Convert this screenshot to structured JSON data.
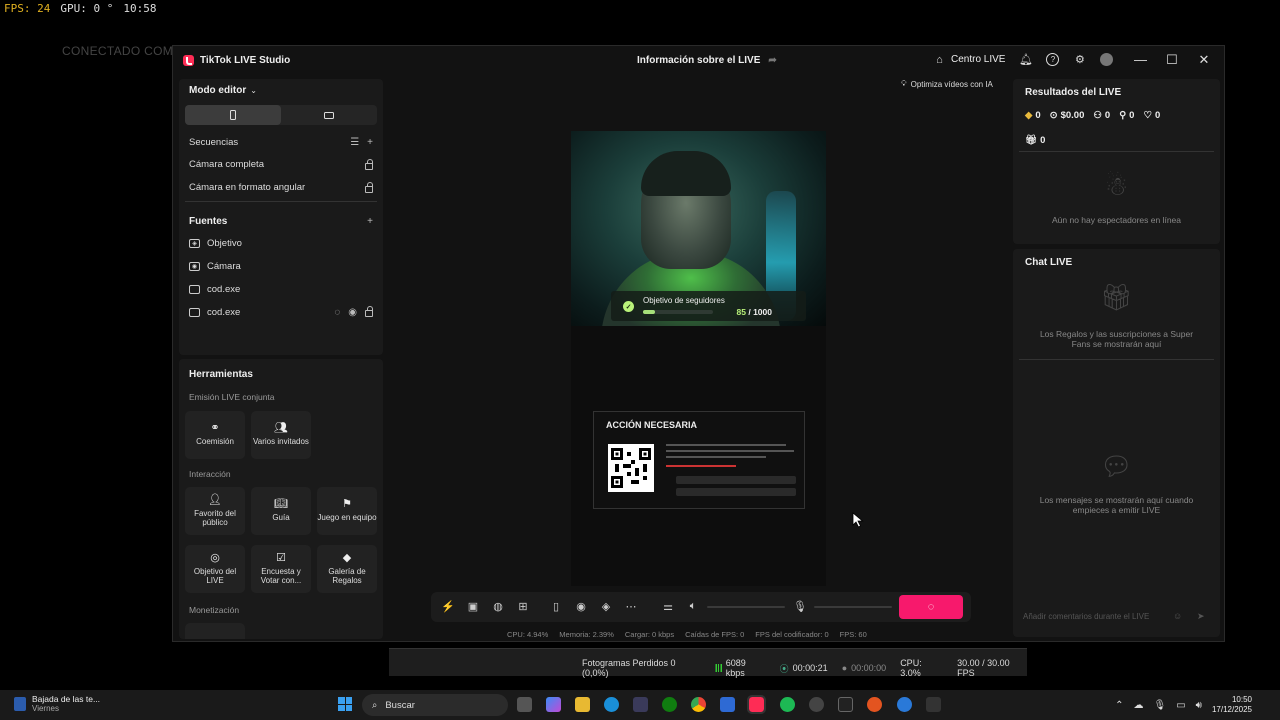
{
  "overlay": {
    "fps": "FPS:  24",
    "gpu": "GPU: 0 °",
    "time": "10:58"
  },
  "background_text": "CONECTADO COMO JOSE",
  "titlebar": {
    "app_name": "TikTok LIVE Studio",
    "center_title": "Información sobre el LIVE",
    "centro_live": "Centro LIVE"
  },
  "editor": {
    "mode_label": "Modo editor",
    "sequences_header": "Secuencias",
    "sequences": [
      "Cámara completa",
      "Cámara en formato angular"
    ],
    "sources_header": "Fuentes",
    "sources": [
      {
        "label": "Objetivo",
        "icon": "shield-icon"
      },
      {
        "label": "Cámara",
        "icon": "camera-icon"
      },
      {
        "label": "cod.exe",
        "icon": "window-icon"
      },
      {
        "label": "cod.exe",
        "icon": "window-icon"
      }
    ]
  },
  "tools": {
    "header": "Herramientas",
    "sections": {
      "joint": "Emisión LIVE conjunta",
      "interaction": "Interacción",
      "monetization": "Monetización"
    },
    "joint": [
      "Coemisión",
      "Varios invitados"
    ],
    "interaction": [
      "Favorito del público",
      "Guía",
      "Juego en equipo",
      "Objetivo del LIVE",
      "Encuesta y Votar con...",
      "Galería de Regalos"
    ]
  },
  "stage": {
    "goal_label": "Objetivo de seguidores",
    "goal_current": "85",
    "goal_total": "/ 1000",
    "goal_progress": 0.085,
    "alert_title": "ACCIÓN NECESARIA"
  },
  "optimize_label": "Optimiza vídeos con IA",
  "stats": {
    "cpu": "CPU: 4.94%",
    "memory": "Memoria: 2.39%",
    "load": "Cargar: 0 kbps",
    "fps_drops": "Caídas de FPS: 0",
    "encoder_fps": "FPS del codificador: 0",
    "fps": "FPS: 60"
  },
  "results": {
    "title": "Resultados del LIVE",
    "diamonds": "0",
    "earnings": "$0.00",
    "viewers": "0",
    "followers": "0",
    "likes": "0",
    "gifts": "0",
    "empty_text": "Aún no hay espectadores en línea"
  },
  "chat": {
    "title": "Chat LIVE",
    "gifts_empty": "Los Regalos y las suscripciones a Super Fans se mostrarán aquí",
    "messages_empty": "Los mensajes se mostrarán aquí cuando empieces a emitir LIVE",
    "input_placeholder": "Añadir comentarios durante el LIVE"
  },
  "obs": {
    "dropped": "Fotogramas Perdidos 0 (0,0%)",
    "bitrate": "6089 kbps",
    "stream_time": "00:00:21",
    "rec_time": "00:00:00",
    "cpu": "CPU: 3.0%",
    "fps": "30.00 / 30.00 FPS"
  },
  "taskbar": {
    "notif_title": "Bajada de las te...",
    "notif_sub": "Viernes",
    "search": "Buscar",
    "time": "10:50",
    "date": "17/12/2025"
  },
  "colors": {
    "accent": "#f7196c",
    "goal": "#b9f27a"
  }
}
